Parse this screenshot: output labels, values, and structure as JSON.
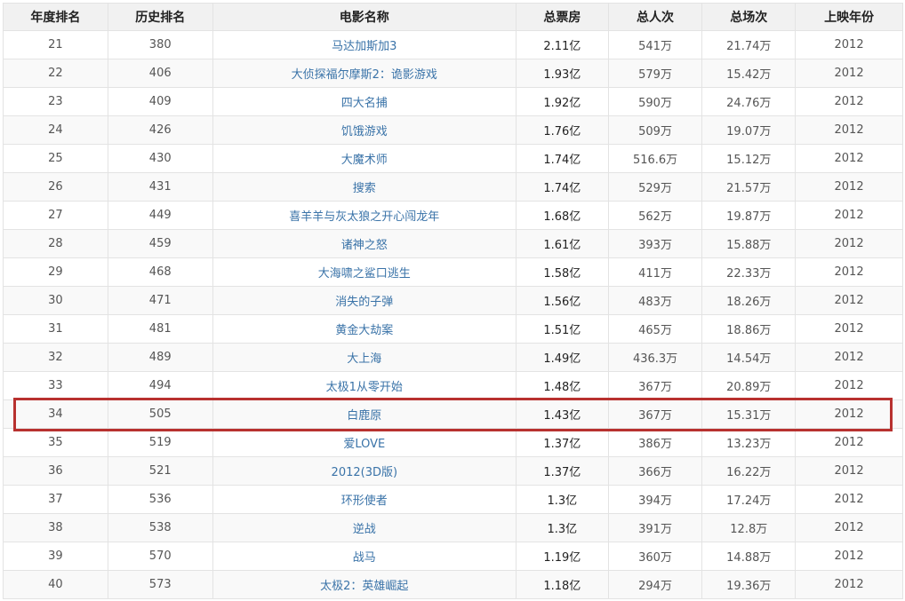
{
  "columns": [
    "年度排名",
    "历史排名",
    "电影名称",
    "总票房",
    "总人次",
    "总场次",
    "上映年份"
  ],
  "rows": [
    {
      "rank": "21",
      "hist": "380",
      "title": "马达加斯加3",
      "box": "2.11亿",
      "people": "541万",
      "shows": "21.74万",
      "year": "2012"
    },
    {
      "rank": "22",
      "hist": "406",
      "title": "大侦探福尔摩斯2：诡影游戏",
      "box": "1.93亿",
      "people": "579万",
      "shows": "15.42万",
      "year": "2012"
    },
    {
      "rank": "23",
      "hist": "409",
      "title": "四大名捕",
      "box": "1.92亿",
      "people": "590万",
      "shows": "24.76万",
      "year": "2012"
    },
    {
      "rank": "24",
      "hist": "426",
      "title": "饥饿游戏",
      "box": "1.76亿",
      "people": "509万",
      "shows": "19.07万",
      "year": "2012"
    },
    {
      "rank": "25",
      "hist": "430",
      "title": "大魔术师",
      "box": "1.74亿",
      "people": "516.6万",
      "shows": "15.12万",
      "year": "2012"
    },
    {
      "rank": "26",
      "hist": "431",
      "title": "搜索",
      "box": "1.74亿",
      "people": "529万",
      "shows": "21.57万",
      "year": "2012"
    },
    {
      "rank": "27",
      "hist": "449",
      "title": "喜羊羊与灰太狼之开心闯龙年",
      "box": "1.68亿",
      "people": "562万",
      "shows": "19.87万",
      "year": "2012"
    },
    {
      "rank": "28",
      "hist": "459",
      "title": "诸神之怒",
      "box": "1.61亿",
      "people": "393万",
      "shows": "15.88万",
      "year": "2012"
    },
    {
      "rank": "29",
      "hist": "468",
      "title": "大海啸之鲨口逃生",
      "box": "1.58亿",
      "people": "411万",
      "shows": "22.33万",
      "year": "2012"
    },
    {
      "rank": "30",
      "hist": "471",
      "title": "消失的子弹",
      "box": "1.56亿",
      "people": "483万",
      "shows": "18.26万",
      "year": "2012"
    },
    {
      "rank": "31",
      "hist": "481",
      "title": "黄金大劫案",
      "box": "1.51亿",
      "people": "465万",
      "shows": "18.86万",
      "year": "2012"
    },
    {
      "rank": "32",
      "hist": "489",
      "title": "大上海",
      "box": "1.49亿",
      "people": "436.3万",
      "shows": "14.54万",
      "year": "2012"
    },
    {
      "rank": "33",
      "hist": "494",
      "title": "太极1从零开始",
      "box": "1.48亿",
      "people": "367万",
      "shows": "20.89万",
      "year": "2012"
    },
    {
      "rank": "34",
      "hist": "505",
      "title": "白鹿原",
      "box": "1.43亿",
      "people": "367万",
      "shows": "15.31万",
      "year": "2012"
    },
    {
      "rank": "35",
      "hist": "519",
      "title": "爱LOVE",
      "box": "1.37亿",
      "people": "386万",
      "shows": "13.23万",
      "year": "2012"
    },
    {
      "rank": "36",
      "hist": "521",
      "title": "2012(3D版)",
      "box": "1.37亿",
      "people": "366万",
      "shows": "16.22万",
      "year": "2012"
    },
    {
      "rank": "37",
      "hist": "536",
      "title": "环形使者",
      "box": "1.3亿",
      "people": "394万",
      "shows": "17.24万",
      "year": "2012"
    },
    {
      "rank": "38",
      "hist": "538",
      "title": "逆战",
      "box": "1.3亿",
      "people": "391万",
      "shows": "12.8万",
      "year": "2012"
    },
    {
      "rank": "39",
      "hist": "570",
      "title": "战马",
      "box": "1.19亿",
      "people": "360万",
      "shows": "14.88万",
      "year": "2012"
    },
    {
      "rank": "40",
      "hist": "573",
      "title": "太极2：英雄崛起",
      "box": "1.18亿",
      "people": "294万",
      "shows": "19.36万",
      "year": "2012"
    }
  ],
  "highlight": {
    "row_rank": "34",
    "color": "#b8312f"
  },
  "colors": {
    "link": "#3a73a8",
    "header_bg": "#f1f1f1",
    "border": "#e3e3e3"
  }
}
